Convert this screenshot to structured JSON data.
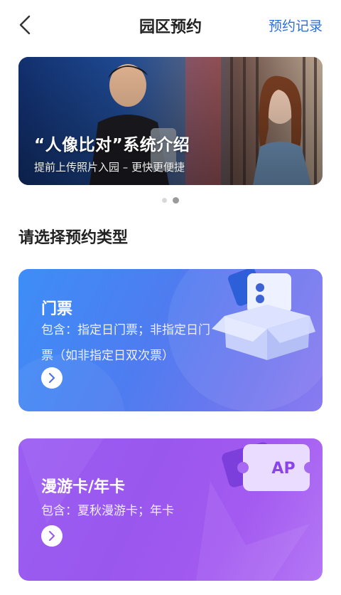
{
  "header": {
    "title": "园区预约",
    "records_label": "预约记录"
  },
  "banner": {
    "title": "“人像比对”系统介绍",
    "subtitle": "提前上传照片入园 – 更快更便捷"
  },
  "carousel": {
    "count": 2,
    "active_index": 1
  },
  "section": {
    "title": "请选择预约类型"
  },
  "cards": [
    {
      "title": "门票",
      "desc": "包含：指定日门票；非指定日门票（如非指定日双次票）",
      "icon": "ticket-box-icon"
    },
    {
      "title": "漫游卡/年卡",
      "desc": "包含：夏秋漫游卡；年卡",
      "icon_label": "AP",
      "icon": "ap-pass-icon"
    }
  ],
  "colors": {
    "accent_link": "#2a6fe0",
    "ticket_card": "#4f7cf0",
    "pass_card": "#9a57ee"
  }
}
